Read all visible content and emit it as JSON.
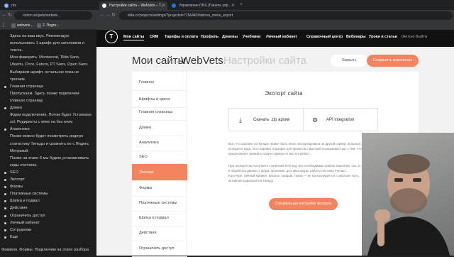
{
  "browser": {
    "tabs": [
      {
        "label": "ntx"
      },
      {
        "label": "Настройки сайта – WebVets – Т..."
      },
      {
        "label": "Управление DNS (Панель упр..."
      }
    ],
    "address_left": "notion.so/petsmarkete...",
    "address_main": "tilda.cc/projects/settings/?projectid=7156442#tab=ss_menu_export",
    "bookmarks": [
      {
        "label": "webvets..."
      },
      {
        "label": "2. Подго..."
      }
    ]
  },
  "notes": {
    "lines": [
      {
        "text": "Здесь на ваш вкус. Рекомендую",
        "bullet": false
      },
      {
        "text": "использовать 1 шрифт для заголовков и",
        "bullet": false
      },
      {
        "text": "текста.",
        "bullet": false
      },
      {
        "text": "Мои фаворить: Montserrat, Tilda Sans,",
        "bullet": false
      },
      {
        "text": "Ubuntu, Circe, Futura, PT Sans, Open Sans.",
        "bullet": false
      },
      {
        "text": "Выбираем шрифт, остальное пока не",
        "bullet": false
      },
      {
        "text": "трогаем",
        "bullet": false
      },
      {
        "text": "Главная страница",
        "bullet": true
      },
      {
        "text": "Пропускаем. Здесь позже подключим",
        "bullet": false
      },
      {
        "text": "главную страницу",
        "bullet": false
      },
      {
        "text": "Домен",
        "bullet": true
      },
      {
        "text": "Ждем подключения. Потом будет Установка",
        "bullet": false
      },
      {
        "text": "ssl. Редиректы с www на без www.",
        "bullet": false
      },
      {
        "text": "Аналитика",
        "bullet": true
      },
      {
        "text": "Позже можно будет посмотреть родную",
        "bullet": false
      },
      {
        "text": "статистику Тильды и сравнить ее с Яндекс",
        "bullet": false
      },
      {
        "text": "Метрикой.",
        "bullet": false
      },
      {
        "text": "Позже на этапе 6 мы будем устанавливать",
        "bullet": false
      },
      {
        "text": "коды счетчика.",
        "bullet": false
      },
      {
        "text": "SEO",
        "bullet": true
      },
      {
        "text": "Экспорт",
        "bullet": true
      },
      {
        "text": "Формы",
        "bullet": true
      },
      {
        "text": "Платежные системы",
        "bullet": true
      },
      {
        "text": "Шапка и подвал",
        "bullet": true
      },
      {
        "text": "Действия",
        "bullet": true
      },
      {
        "text": "Ограничить доступ",
        "bullet": true
      },
      {
        "text": "Личный кабинет",
        "bullet": true
      },
      {
        "text": "Сотрудники",
        "bullet": true
      },
      {
        "text": "Еще",
        "bullet": true
      }
    ],
    "footer": "Фавикон. Формы. Подключим на этапе разбора"
  },
  "tilda": {
    "logo": "T",
    "menu": [
      "Мои сайты",
      "CRM",
      "Тарифы и оплата",
      "Профиль",
      "Домены",
      "Учебники",
      "Личный кабинет"
    ],
    "menu_right": [
      "Справочный центр",
      "Вебинары",
      "Уроки и статьи",
      "(Антон) Выйти"
    ],
    "breadcrumb": {
      "root": "Мои сайты",
      "arrow": "→",
      "site": "WebVets",
      "current": "Настройки сайта"
    },
    "close_button": "Закрыть",
    "save_button": "Сохранить изменения",
    "sidebar": [
      "Главное",
      "Шрифты и цвета",
      "Главная страница",
      "Домен",
      "Аналитика",
      "SEO",
      "Экспорт",
      "Формы",
      "Платежные системы",
      "Шапка и подвал",
      "Действия",
      "Ограничить доступ"
    ],
    "active_sidebar": "Экспорт",
    "export": {
      "title": "Экспорт сайта",
      "download_zip": "Скачать .zip архив",
      "api_integration": "API integration",
      "paragraph1": [
        "Все, что сделано на Тильде, может быть легко экспортировано на другой сервер, использу...",
        "исходного кода. Этот вариант подходит для проектов с высокой посещаемостью, с тем, что...",
        "предполагает знаний в сфере сервера от вас потребует..."
      ],
      "paragraph2": [
        "При экспорте вы получаете статичный html-код: все необходимые файлы (картинки, css, js...",
        "и обработка данных с форм, хранение, доставка форм, работы системы Femato...",
        "FaceType. Личный кабинет. Каталог товаров. Поиск — не контролируется с работает поту...",
        "активной подпиской на Тильду."
      ],
      "special_button": "Специальные настройки экспорта"
    }
  },
  "colors": {
    "accent": "#f4845f",
    "header_bg": "#111111",
    "notes_bg": "#1e1e1e"
  }
}
